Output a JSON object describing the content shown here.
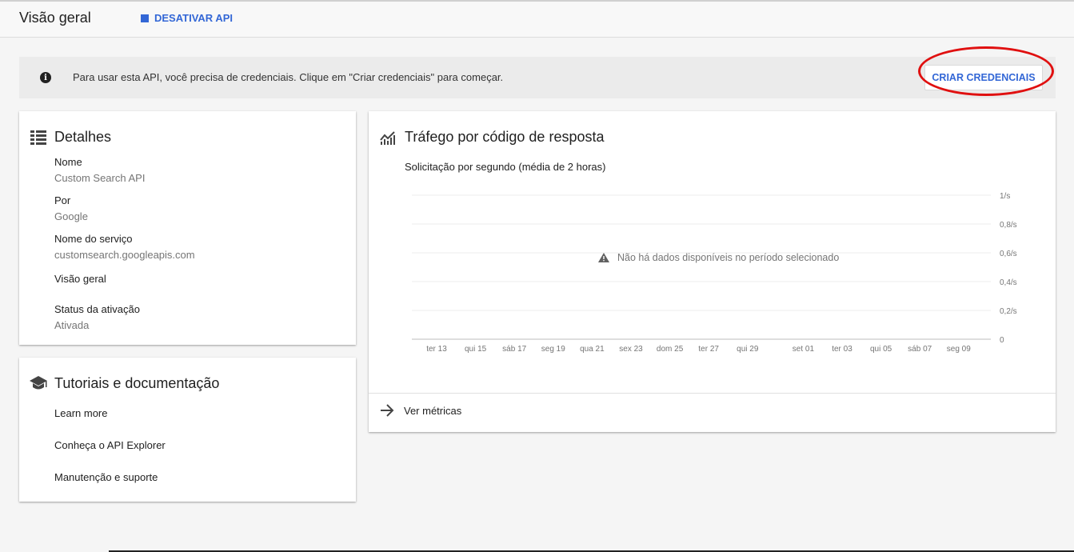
{
  "header": {
    "title": "Visão geral",
    "disable_api_label": "DESATIVAR API"
  },
  "banner": {
    "message": "Para usar esta API, você precisa de credenciais. Clique em \"Criar credenciais\" para começar.",
    "cta_label": "CRIAR CREDENCIAIS"
  },
  "details": {
    "title": "Detalhes",
    "fields": [
      {
        "label": "Nome",
        "value": "Custom Search API"
      },
      {
        "label": "Por",
        "value": "Google"
      },
      {
        "label": "Nome do serviço",
        "value": "customsearch.googleapis.com"
      },
      {
        "label": "Visão geral",
        "value": ""
      },
      {
        "label": "Status da ativação",
        "value": "Ativada"
      }
    ]
  },
  "tutorials": {
    "title": "Tutoriais e documentação",
    "links": [
      "Learn more",
      "Conheça o API Explorer",
      "Manutenção e suporte"
    ]
  },
  "traffic": {
    "title": "Tráfego por código de resposta",
    "subtitle": "Solicitação por segundo (média de 2 horas)",
    "no_data_message": "Não há dados disponíveis no período selecionado",
    "metrics_link": "Ver métricas"
  },
  "chart_data": {
    "type": "line",
    "title": "Tráfego por código de resposta",
    "subtitle": "Solicitação por segundo (média de 2 horas)",
    "x": [
      "ter 13",
      "qui 15",
      "sáb 17",
      "seg 19",
      "qua 21",
      "sex 23",
      "dom 25",
      "ter 27",
      "qui 29",
      "set 01",
      "ter 03",
      "qui 05",
      "sáb 07",
      "seg 09"
    ],
    "y_ticks": [
      "1/s",
      "0,8/s",
      "0,6/s",
      "0,4/s",
      "0,2/s",
      "0"
    ],
    "ylim": [
      0,
      1
    ],
    "series": [],
    "grid": true,
    "annotation": "Não há dados disponíveis no período selecionado"
  },
  "colors": {
    "accent": "#3367d6",
    "highlight": "#e01010"
  }
}
